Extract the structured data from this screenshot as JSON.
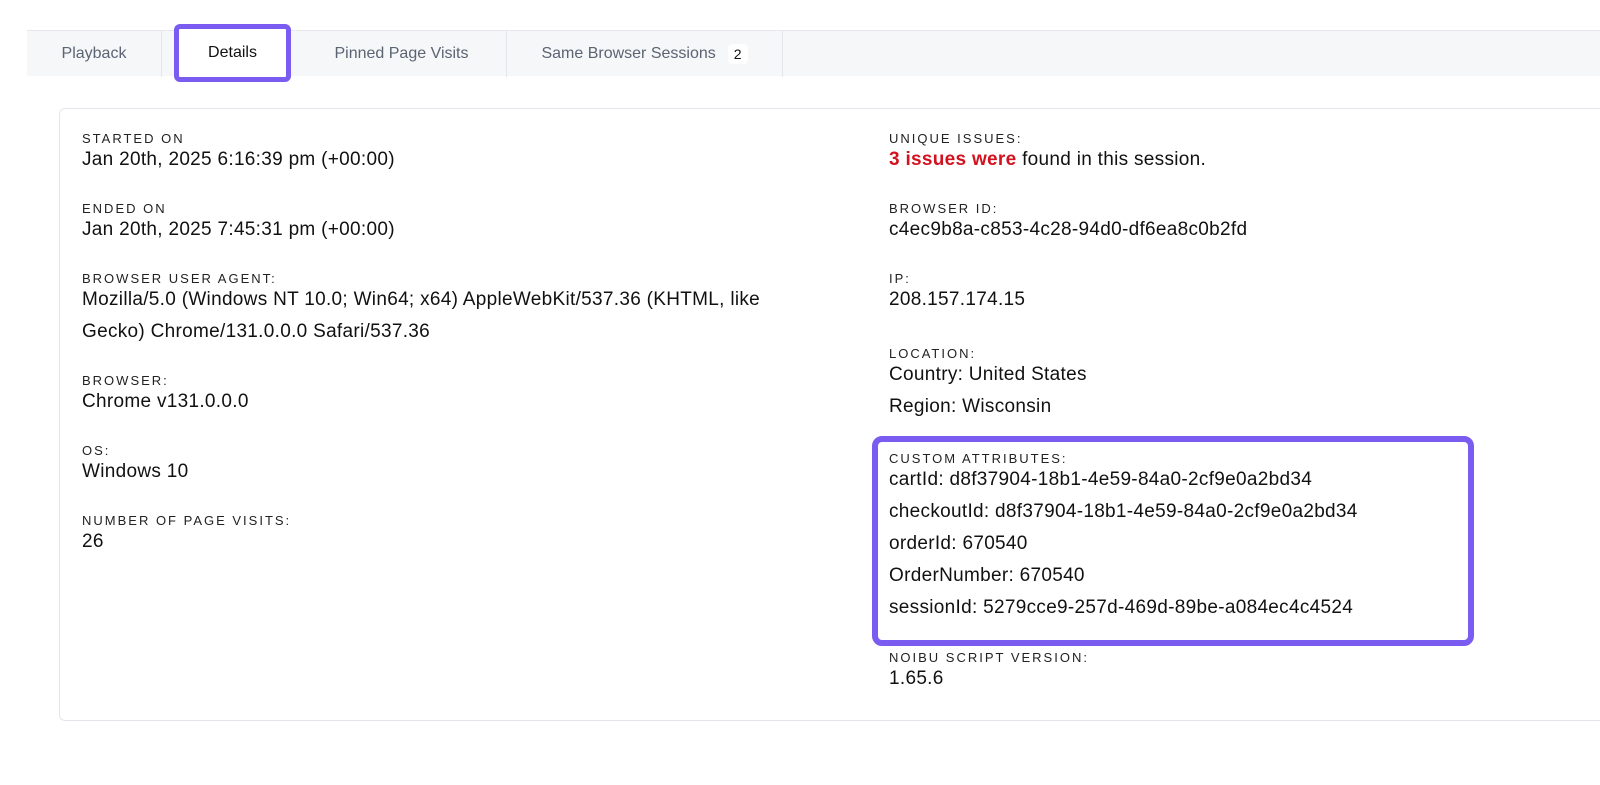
{
  "tabs": {
    "playback": "Playback",
    "details": "Details",
    "pinned": "Pinned Page Visits",
    "same_browser": "Same Browser Sessions",
    "same_browser_count": "2"
  },
  "details": {
    "started_on": {
      "label": "STARTED ON",
      "value": "Jan 20th, 2025 6:16:39 pm (+00:00)"
    },
    "ended_on": {
      "label": "ENDED ON",
      "value": "Jan 20th, 2025 7:45:31 pm (+00:00)"
    },
    "user_agent": {
      "label": "BROWSER USER AGENT:",
      "line1": "Mozilla/5.0 (Windows NT 10.0; Win64; x64) AppleWebKit/537.36 (KHTML, like",
      "line2": "Gecko) Chrome/131.0.0.0 Safari/537.36"
    },
    "browser": {
      "label": "BROWSER:",
      "value": "Chrome v131.0.0.0"
    },
    "os": {
      "label": "OS:",
      "value": "Windows 10"
    },
    "page_visits": {
      "label": "NUMBER OF PAGE VISITS:",
      "value": "26"
    },
    "unique_issues": {
      "label": "UNIQUE ISSUES:",
      "highlight": "3 issues were",
      "rest": " found in this session."
    },
    "browser_id": {
      "label": "BROWSER ID:",
      "value": "c4ec9b8a-c853-4c28-94d0-df6ea8c0b2fd"
    },
    "ip": {
      "label": "IP:",
      "value": "208.157.174.15"
    },
    "location": {
      "label": "LOCATION:",
      "country": "Country: United States",
      "region": "Region: Wisconsin"
    },
    "custom_attributes": {
      "label": "CUSTOM ATTRIBUTES:",
      "items": [
        "cartId: d8f37904-18b1-4e59-84a0-2cf9e0a2bd34",
        "checkoutId: d8f37904-18b1-4e59-84a0-2cf9e0a2bd34",
        "orderId: 670540",
        "OrderNumber: 670540",
        "sessionId: 5279cce9-257d-469d-89be-a084ec4c4524"
      ]
    },
    "script_version": {
      "label": "NOIBU SCRIPT VERSION:",
      "value": "1.65.6"
    }
  },
  "colors": {
    "accent": "#7b5cf0",
    "issue_red": "#d3121f"
  }
}
